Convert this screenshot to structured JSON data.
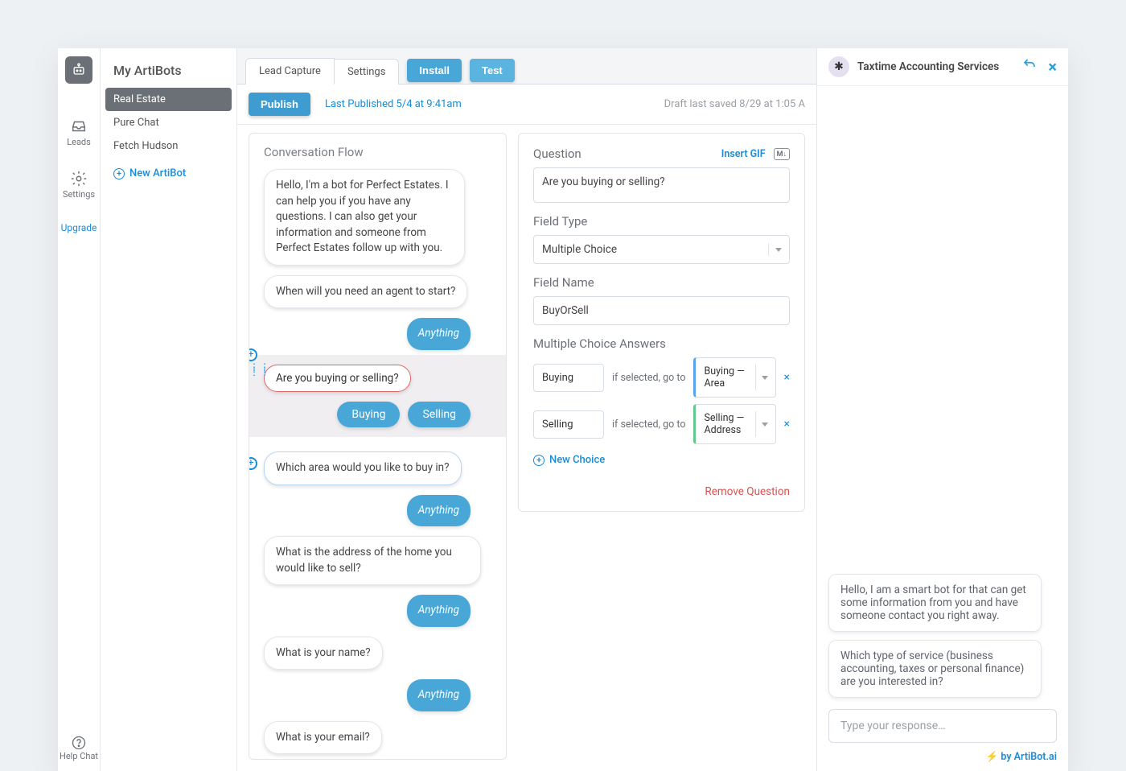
{
  "rail": {
    "leads": "Leads",
    "settings": "Settings",
    "upgrade": "Upgrade",
    "help": "Help Chat"
  },
  "sidebar": {
    "title": "My ArtiBots",
    "items": [
      "Real Estate",
      "Pure Chat",
      "Fetch Hudson"
    ],
    "new": "New ArtiBot"
  },
  "tabs": {
    "lead": "Lead Capture",
    "settings": "Settings"
  },
  "buttons": {
    "install": "Install",
    "test": "Test",
    "publish": "Publish"
  },
  "toolbar": {
    "last": "Last Published 5/4 at 9:41am",
    "draft": "Draft last saved 8/29 at 1:05 A"
  },
  "flow": {
    "title": "Conversation Flow",
    "b1": "Hello, I'm a bot for Perfect Estates. I can help you if you have any questions. I can also get your information and someone from Perfect Estates follow up with you.",
    "b2": "When will you need an agent to start?",
    "anything": "Anything",
    "sel": "Are you buying or selling?",
    "c1": "Buying",
    "c2": "Selling",
    "b3": "Which area would you like to buy in?",
    "b4": "What is the address of the home you would like to sell?",
    "b5": "What is your name?",
    "b6": "What is your email?"
  },
  "config": {
    "question": "Question",
    "insertGif": "Insert GIF",
    "md": "M↓",
    "qVal": "Are you buying or selling?",
    "fieldType": "Field Type",
    "fieldTypeVal": "Multiple Choice",
    "fieldName": "Field Name",
    "fieldNameVal": "BuyOrSell",
    "answers": "Multiple Choice Answers",
    "a1": "Buying",
    "a2": "Selling",
    "goto": "if selected, go to",
    "g1": "Buying — Area",
    "g2": "Selling — Address",
    "newChoice": "New Choice",
    "remove": "Remove Question"
  },
  "preview": {
    "title": "Taxtime Accounting Services",
    "m1": "Hello, I am a smart bot for that can get some information from you and have someone contact you right away.",
    "m2": "Which type of service (business accounting, taxes or personal finance) are you interested in?",
    "placeholder": "Type your response…",
    "footer": "by ArtiBot.ai"
  }
}
